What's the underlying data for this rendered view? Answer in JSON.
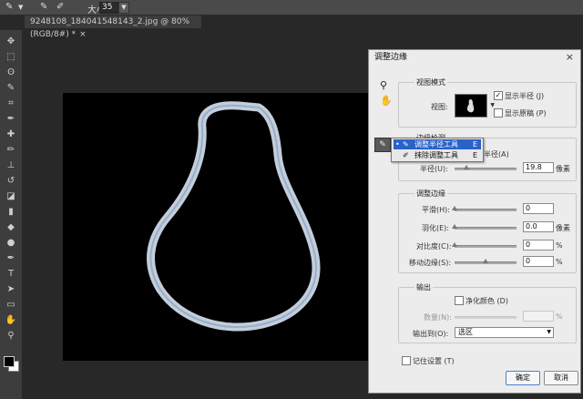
{
  "options_bar": {
    "size_label": "大小:",
    "size_value": "35"
  },
  "document_tab": {
    "title": "9248108_184041548143_2.jpg @ 80%(RGB/8#) *",
    "close": "×"
  },
  "tools": [
    {
      "name": "move-tool",
      "glyph": "✥"
    },
    {
      "name": "marquee-tool",
      "glyph": "⬚"
    },
    {
      "name": "lasso-tool",
      "glyph": "ʘ"
    },
    {
      "name": "quick-selection-tool",
      "glyph": "✎"
    },
    {
      "name": "crop-tool",
      "glyph": "⌗"
    },
    {
      "name": "eyedropper-tool",
      "glyph": "✒"
    },
    {
      "name": "spot-healing-tool",
      "glyph": "✚"
    },
    {
      "name": "brush-tool",
      "glyph": "✏"
    },
    {
      "name": "clone-stamp-tool",
      "glyph": "⊥"
    },
    {
      "name": "history-brush-tool",
      "glyph": "↺"
    },
    {
      "name": "eraser-tool",
      "glyph": "◪"
    },
    {
      "name": "gradient-tool",
      "glyph": "▮"
    },
    {
      "name": "blur-tool",
      "glyph": "◆"
    },
    {
      "name": "dodge-tool",
      "glyph": "●"
    },
    {
      "name": "pen-tool",
      "glyph": "✒"
    },
    {
      "name": "type-tool",
      "glyph": "T"
    },
    {
      "name": "path-selection-tool",
      "glyph": "➤"
    },
    {
      "name": "shape-tool",
      "glyph": "▭"
    },
    {
      "name": "hand-tool",
      "glyph": "✋"
    },
    {
      "name": "zoom-tool",
      "glyph": "⚲"
    }
  ],
  "dialog": {
    "title": "调整边缘",
    "close": "×",
    "view_mode": {
      "title": "视图模式",
      "view_label": "视图:",
      "show_radius": "显示半径 (J)",
      "show_radius_checked": true,
      "show_original": "显示原稿 (P)",
      "show_original_checked": false
    },
    "edge_detection": {
      "title": "边缘检测",
      "smart_radius": "半径(A)",
      "radius_label": "半径(U):",
      "radius_value": "19.8",
      "radius_unit": "像素",
      "radius_level": 0.19
    },
    "tool_flyout": {
      "items": [
        {
          "label": "调整半径工具",
          "key": "E",
          "selected": true
        },
        {
          "label": "抹除调整工具",
          "key": "E",
          "selected": false
        }
      ]
    },
    "adjust_edge": {
      "title": "调整边缘",
      "rows": [
        {
          "label": "平滑(H):",
          "value": "0",
          "unit": "",
          "level": 0
        },
        {
          "label": "羽化(E):",
          "value": "0.0",
          "unit": "像素",
          "level": 0
        },
        {
          "label": "对比度(C):",
          "value": "0",
          "unit": "%",
          "level": 0
        },
        {
          "label": "移动边缘(S):",
          "value": "0",
          "unit": "%",
          "level": 0.5
        }
      ]
    },
    "output": {
      "title": "输出",
      "decontaminate": "净化颜色 (D)",
      "amount_label": "数量(N):",
      "amount_unit": "%",
      "output_to_label": "输出到(O):",
      "output_to_value": "选区"
    },
    "remember": "记住设置 (T)",
    "ok": "确定",
    "cancel": "取消"
  }
}
